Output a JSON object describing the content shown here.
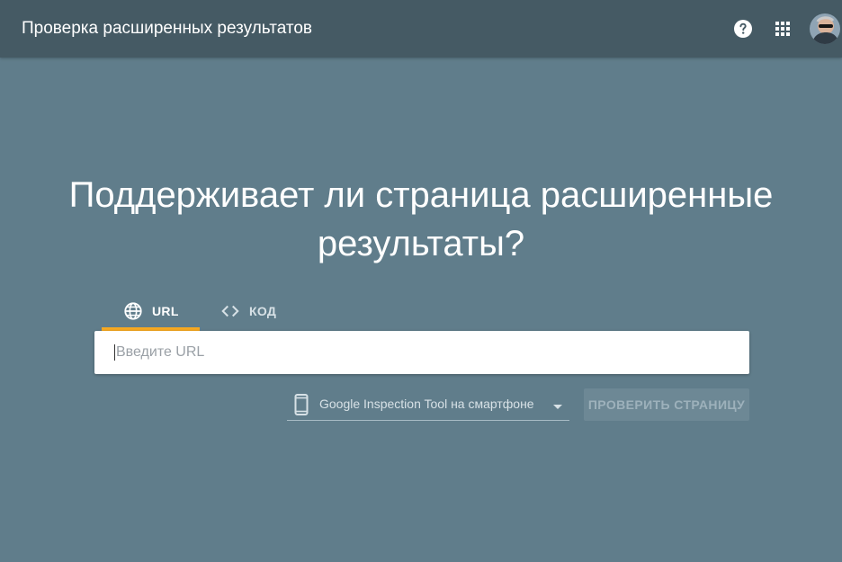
{
  "app": {
    "title": "Проверка расширенных результатов"
  },
  "header_icons": {
    "help": "help-icon",
    "apps": "apps-grid-icon",
    "avatar": "user-avatar"
  },
  "main": {
    "headline_line1": "Поддерживает ли страница расширенные",
    "headline_line2": "результаты?"
  },
  "tabs": [
    {
      "label": "URL",
      "icon": "globe-icon",
      "selected": true
    },
    {
      "label": "КОД",
      "icon": "code-icon",
      "selected": false
    }
  ],
  "url_input": {
    "placeholder": "Введите URL",
    "value": ""
  },
  "device_select": {
    "icon": "smartphone-icon",
    "selected": "Google Inspection Tool на смартфоне"
  },
  "check_button": {
    "label": "ПРОВЕРИТЬ СТРАНИЦУ",
    "enabled": false
  },
  "colors": {
    "background": "#607d8b",
    "appbar": "#455a64",
    "tab_indicator": "#f6a821"
  }
}
